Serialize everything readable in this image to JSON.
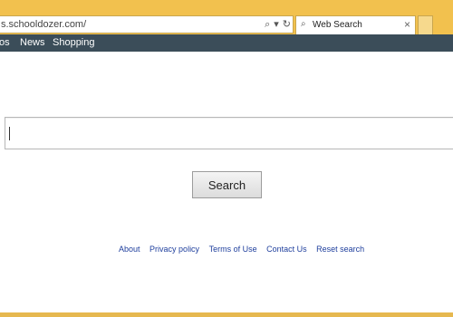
{
  "browser": {
    "address": "s.schooldozer.com/",
    "tab": {
      "title": "Web Search",
      "icon": "search-icon"
    },
    "colors": {
      "chrome": "#f2c14e",
      "navbar": "#3b4d59",
      "link": "#1f3f9d"
    },
    "icons": {
      "search": "search-icon",
      "dropdown": "chevron-down-icon",
      "refresh": "refresh-icon",
      "close": "close-icon",
      "new_tab": "new-tab-icon"
    }
  },
  "nav": {
    "items": [
      {
        "label": "os"
      },
      {
        "label": "News"
      },
      {
        "label": "Shopping"
      }
    ]
  },
  "search": {
    "value": "",
    "placeholder": "",
    "button_label": "Search"
  },
  "footer": {
    "links": [
      {
        "label": "About"
      },
      {
        "label": "Privacy policy"
      },
      {
        "label": "Terms of Use"
      },
      {
        "label": "Contact Us"
      },
      {
        "label": "Reset search"
      }
    ]
  }
}
